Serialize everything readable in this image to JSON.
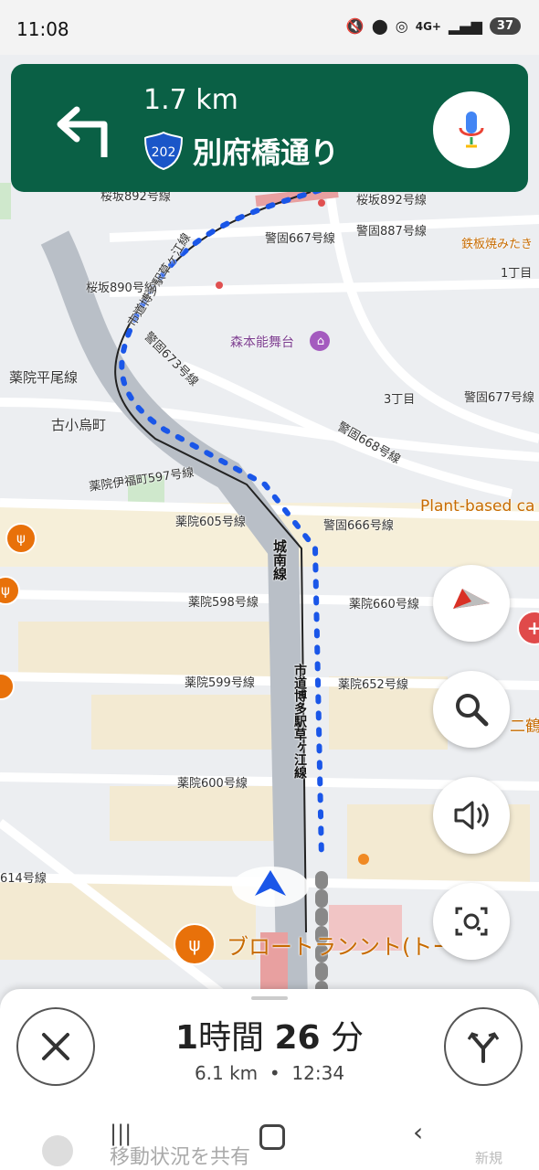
{
  "status": {
    "time": "11:08",
    "network": "4G+",
    "battery": "37"
  },
  "navigation": {
    "distance": "1.7 km",
    "route_number": "202",
    "road_name": "別府橋通り"
  },
  "map_labels": {
    "sakurazaka892": "桜坂892号線",
    "keigo887": "警固887号線",
    "keigo667": "警固667号線",
    "tetsunabe": "鉄板焼みたき",
    "chome1": "1丁目",
    "sakurazaka890": "桜坂890号線",
    "shido": "市道博多駅草ヶ江線",
    "keigo673": "警固673号線",
    "morimoto": "森本能舞台",
    "yakuinhirao": "薬院平尾線",
    "chome3": "3丁目",
    "keigo677": "警固677号線",
    "furukogarasu": "古小烏町",
    "keigo668": "警固668号線",
    "yakuin597": "薬院伊福町597号線",
    "plantbased": "Plant-based ca",
    "yakuin605": "薬院605号線",
    "keigo666": "警固666号線",
    "jonan": "城南線",
    "yakuin598": "薬院598号線",
    "yakuin660": "薬院660号線",
    "yakuin599": "薬院599号線",
    "yakuin652": "薬院652号線",
    "nikaku": "二鶴",
    "yakuin600": "薬院600号線",
    "shido2": "市道博多駅草ヶ江線",
    "road614": "614号線",
    "broteland": "ブロートランント(トーパン"
  },
  "trip": {
    "duration_hours": "1",
    "hours_unit": "時間",
    "duration_minutes": "26",
    "minutes_unit": "分",
    "distance": "6.1 km",
    "separator": "•",
    "arrival": "12:34"
  },
  "share": {
    "label": "移動状況を共有",
    "new_label": "新規"
  },
  "colors": {
    "nav_green": "#0a6045",
    "route_blue": "#1a56e8",
    "accent_orange": "#e8710a"
  }
}
